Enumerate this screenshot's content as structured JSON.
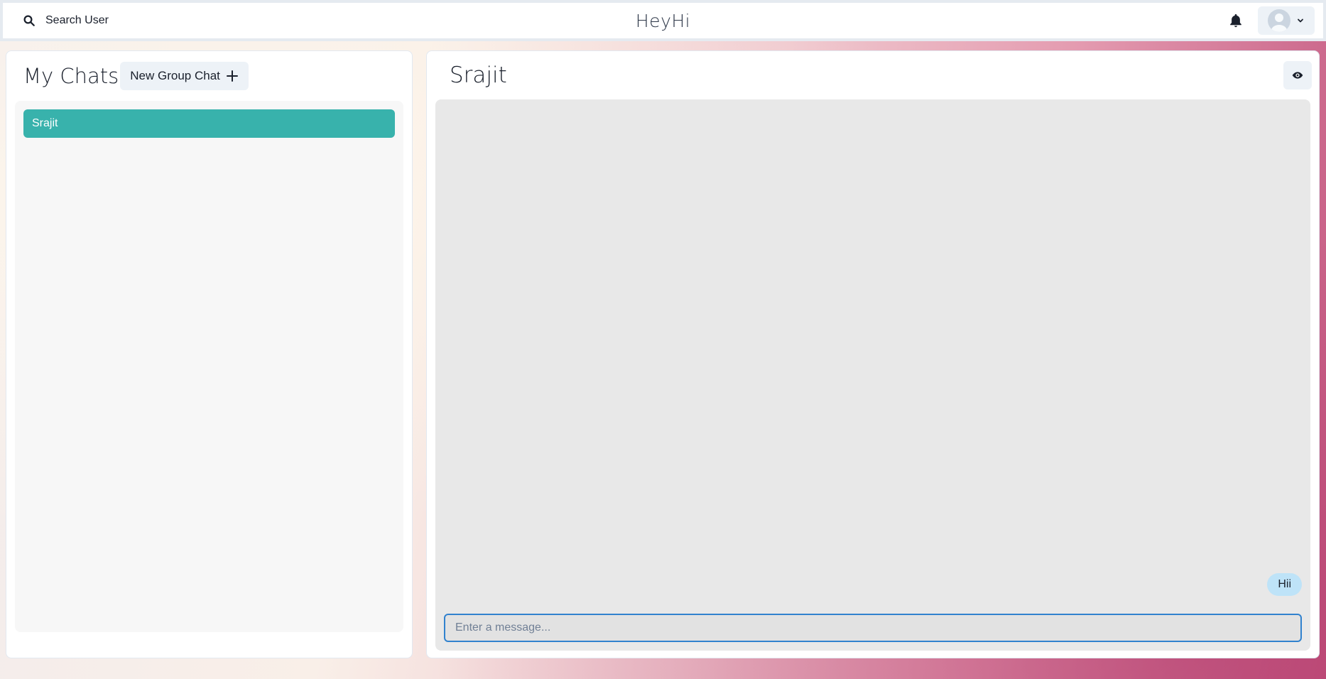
{
  "topbar": {
    "search_label": "Search User",
    "brand": "HeyHi",
    "icons": {
      "search": "search-icon",
      "bell": "bell-icon",
      "avatar": "avatar-icon",
      "chevron": "chevron-down-icon"
    }
  },
  "sidebar": {
    "title": "My Chats",
    "new_group_label": "New Group Chat",
    "chats": [
      {
        "name": "Srajit",
        "selected": true
      }
    ]
  },
  "chat": {
    "title": "Srajit",
    "messages": [
      {
        "text": "Hii",
        "from": "me"
      }
    ],
    "input": {
      "value": "",
      "placeholder": "Enter a message..."
    }
  },
  "colors": {
    "accent_selected": "#38b2ac",
    "bubble_me": "#bee3f8",
    "input_focus": "#3182ce"
  }
}
